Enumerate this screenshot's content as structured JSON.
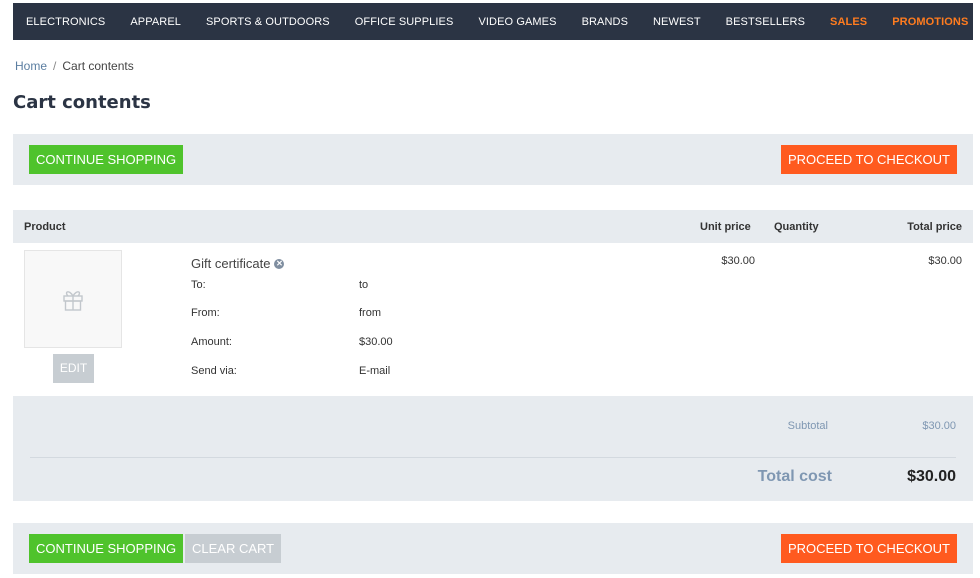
{
  "nav": {
    "items": [
      {
        "label": "ELECTRONICS"
      },
      {
        "label": "APPAREL"
      },
      {
        "label": "SPORTS & OUTDOORS"
      },
      {
        "label": "OFFICE SUPPLIES"
      },
      {
        "label": "VIDEO GAMES"
      },
      {
        "label": "BRANDS"
      },
      {
        "label": "NEWEST"
      },
      {
        "label": "BESTSELLERS"
      }
    ],
    "promo_items": [
      {
        "label": "SALES"
      },
      {
        "label": "PROMOTIONS"
      }
    ]
  },
  "breadcrumb": {
    "home": "Home",
    "separator": "/",
    "current": "Cart contents"
  },
  "page_title": "Cart contents",
  "buttons": {
    "continue_shopping": "CONTINUE SHOPPING",
    "proceed_to_checkout": "PROCEED TO CHECKOUT",
    "clear_cart": "CLEAR CART",
    "edit": "EDIT"
  },
  "table": {
    "headers": {
      "product": "Product",
      "unit_price": "Unit price",
      "quantity": "Quantity",
      "total_price": "Total price"
    },
    "rows": [
      {
        "title": "Gift certificate",
        "options": [
          {
            "label": "To:",
            "value": "to"
          },
          {
            "label": "From:",
            "value": "from"
          },
          {
            "label": "Amount:",
            "value": "$30.00"
          },
          {
            "label": "Send via:",
            "value": "E-mail"
          }
        ],
        "unit_price": "$30.00",
        "total_price": "$30.00"
      }
    ]
  },
  "summary": {
    "subtotal_label": "Subtotal",
    "subtotal_value": "$30.00",
    "total_label": "Total cost",
    "total_value": "$30.00"
  },
  "colors": {
    "nav_bg": "#2b3444",
    "promo": "#ff7c1f",
    "green": "#4fc32c",
    "orange": "#ff5a1f",
    "grey": "#c7cdd2",
    "panel_bg": "#e7ebef"
  },
  "icons": {
    "product_thumb": "gift-icon",
    "remove": "remove-icon"
  }
}
